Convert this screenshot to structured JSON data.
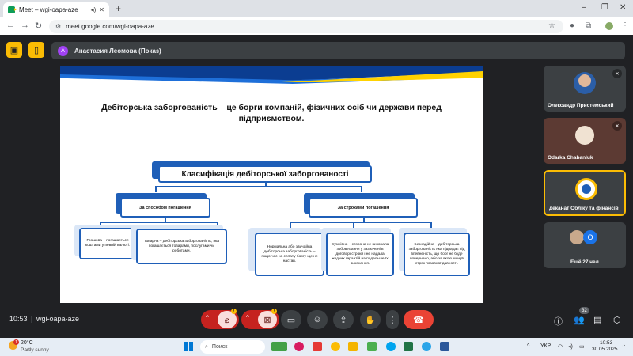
{
  "browser": {
    "tab_title": "Meet – wgi-oapa-aze",
    "new_tab": "+",
    "url": "meet.google.com/wgi-oapa-aze",
    "win_min": "–",
    "win_max": "❐",
    "win_close": "✕"
  },
  "meet": {
    "presenter_initial": "A",
    "presenter_label": "Анастасия Леомова (Показ)",
    "slide": {
      "title": "Дебіторська заборгованість – це борги компаній, фізичних осіб чи держави перед підприємством.",
      "main_box": "Класифікація дебіторської заборгованості",
      "left_branch": "За способом погашення",
      "right_branch": "За строками погашення",
      "leaf1": "Грошова – погашається коштами у певній валюті.",
      "leaf2": "Товарна – дебіторська заборгованість, яка погашається товарами, послугами чи роботами.",
      "leaf3": "Нормальна або звичайна дебіторська заборгованість – якщо час на сплату боргу ще не настав.",
      "leaf4": "Сумнівна – сторона не виконала зобов'язання у зазначені в договорі строки і не надала жодних гарантій на подальше їх виконання.",
      "leaf5": "Безнадійна – дебіторська заборгованість яка підпадає під впевненість, що борг не буде повернено, або за якою минув строк позовної давності."
    },
    "participants": [
      {
        "name": "Олександр Пристемський",
        "muted": true
      },
      {
        "name": "Odarka Chabanluk",
        "muted": true
      },
      {
        "name": "деканат Обліку та фінансів",
        "muted": false
      },
      {
        "name": "Ещё 27 чел.",
        "count_initial": "О"
      }
    ],
    "controls": {
      "time": "10:53",
      "separator": "|",
      "meeting_code": "wgi-oapa-aze",
      "participants_count": "32"
    }
  },
  "taskbar": {
    "weather_temp": "20°C",
    "weather_desc": "Partly sunny",
    "weather_badge": "1",
    "search_placeholder": "Поиск",
    "language": "УКР",
    "time": "10:53",
    "date": "30.05.2025"
  },
  "colors": {
    "meet_bg": "#202124",
    "accent_yellow": "#fbbc04",
    "end_call_red": "#ea4335",
    "slide_blue": "#1f5fb8"
  }
}
